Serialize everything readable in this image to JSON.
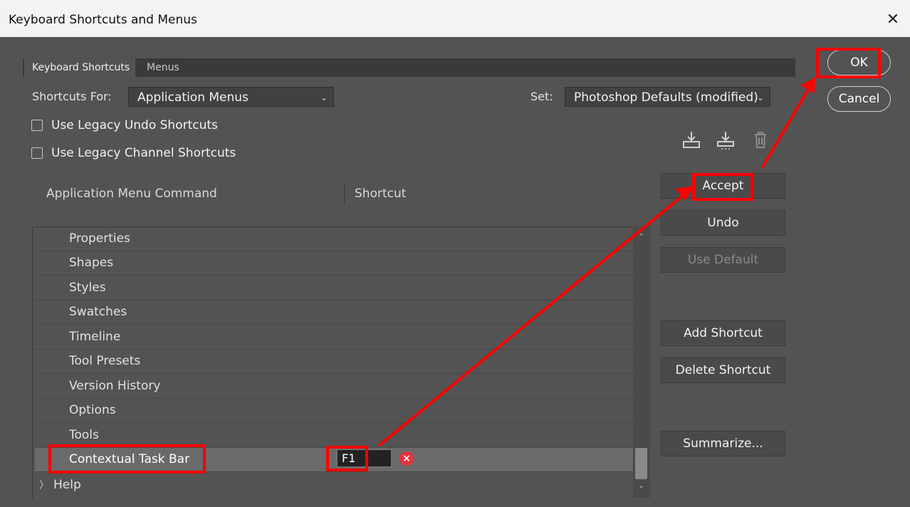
{
  "window": {
    "title": "Keyboard Shortcuts and Menus",
    "close_glyph": "✕"
  },
  "tabs": [
    {
      "label": "Keyboard Shortcuts"
    },
    {
      "label": "Menus"
    }
  ],
  "shortcuts_for": {
    "label": "Shortcuts For:",
    "value": "Application Menus"
  },
  "set": {
    "label": "Set:",
    "value": "Photoshop Defaults (modified)"
  },
  "checkboxes": [
    {
      "label": "Use Legacy Undo Shortcuts",
      "checked": false
    },
    {
      "label": "Use Legacy Channel Shortcuts",
      "checked": false
    }
  ],
  "table": {
    "headers": [
      "Application Menu Command",
      "Shortcut"
    ],
    "rows": [
      {
        "label": "Properties"
      },
      {
        "label": "Shapes"
      },
      {
        "label": "Styles"
      },
      {
        "label": "Swatches"
      },
      {
        "label": "Timeline"
      },
      {
        "label": "Tool Presets"
      },
      {
        "label": "Version History"
      },
      {
        "label": "Options"
      },
      {
        "label": "Tools"
      },
      {
        "label": "Contextual Task Bar",
        "shortcut": "F1",
        "selected": true
      }
    ],
    "help_row": {
      "chevron": "〉",
      "label": "Help"
    }
  },
  "buttons": {
    "accept": "Accept",
    "undo": "Undo",
    "use_default": "Use Default",
    "add_shortcut": "Add Shortcut",
    "delete_shortcut": "Delete Shortcut",
    "summarize": "Summarize...",
    "ok": "OK",
    "cancel": "Cancel"
  },
  "icons": {
    "save_set": "save-set-icon",
    "save_copy": "save-copy-icon",
    "delete_set": "trash-icon",
    "error": "×"
  },
  "colors": {
    "annotation": "#ff0000",
    "dialog_bg": "#535353",
    "error": "#e5323b"
  }
}
